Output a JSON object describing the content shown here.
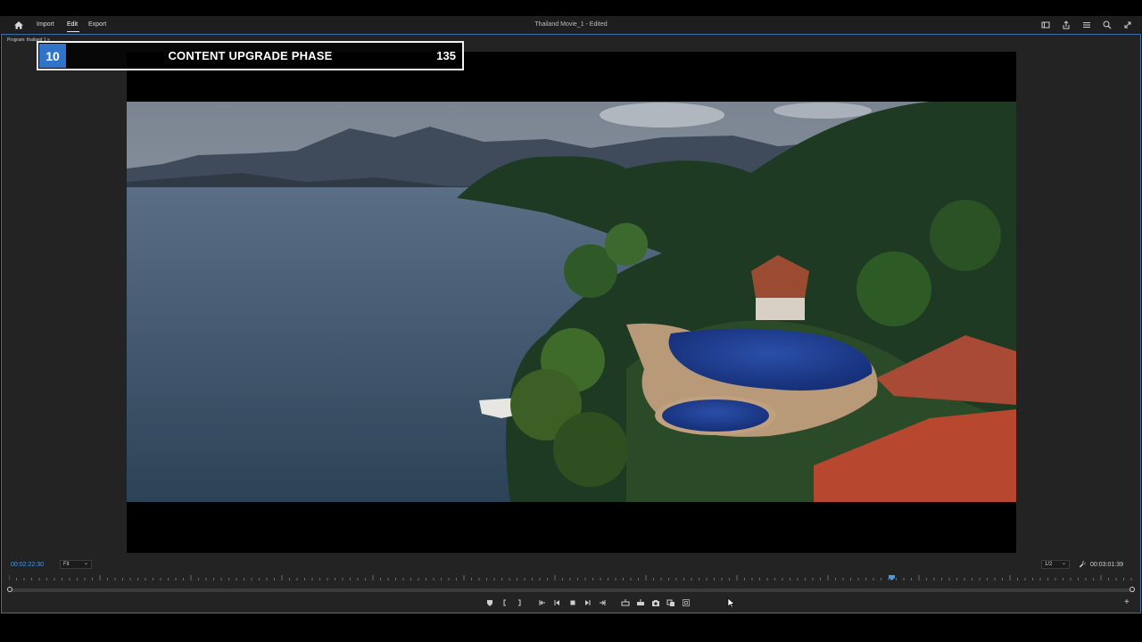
{
  "topbar": {
    "nav": [
      "Import",
      "Edit",
      "Export"
    ],
    "active_nav": "Edit",
    "title": "Thailand Movie_1 - Edited",
    "right_icons": [
      "panel-layout-icon",
      "share-icon",
      "menu-icon",
      "search-icon",
      "expand-icon"
    ]
  },
  "panel": {
    "label": "Program: thailand 1 ≡"
  },
  "overlay": {
    "badge": "10",
    "title": "CONTENT UPGRADE PHASE",
    "number": "135"
  },
  "controls": {
    "timecode_current": "00:02:22:30",
    "fit": "Fit",
    "resolution": "1/2",
    "timecode_duration": "00:03:01:39",
    "add_label": "+"
  },
  "transport_icons": [
    "marker-icon",
    "mark-in-icon",
    "mark-out-icon",
    "go-to-in-icon",
    "step-back-icon",
    "stop-icon",
    "step-forward-icon",
    "go-to-out-icon",
    "insert-icon",
    "overwrite-icon",
    "export-frame-icon",
    "comparison-icon",
    "safe-margins-icon"
  ],
  "colors": {
    "accent": "#2f74c9",
    "timecode": "#4f95e0",
    "panel_border": "#3a6fb0"
  }
}
